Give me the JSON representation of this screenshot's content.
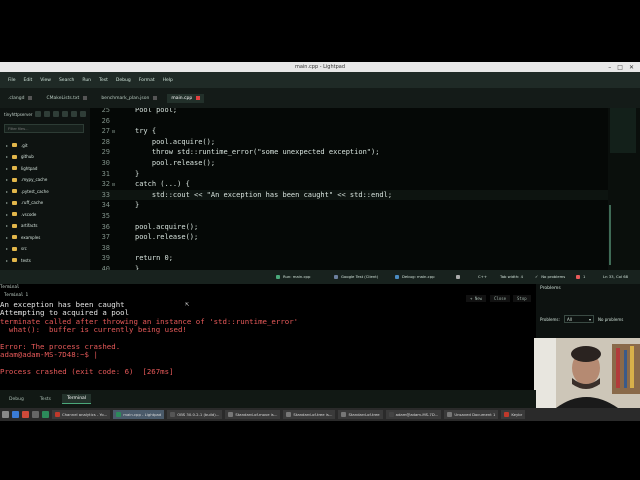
{
  "window": {
    "title": "main.cpp - Lightpad"
  },
  "menu": [
    "File",
    "Edit",
    "View",
    "Search",
    "Run",
    "Test",
    "Debug",
    "Format",
    "Help"
  ],
  "tabs": [
    {
      "label": ".clangd",
      "active": false
    },
    {
      ".label": "",
      "label": "CMakeLists.txt",
      "active": false
    },
    {
      "label": "benchmark_plan.json",
      "active": false
    },
    {
      "label": "main.cpp",
      "active": true
    }
  ],
  "sidebar": {
    "project": "tinyhttpserver",
    "filter_placeholder": "Filter files...",
    "items": [
      ".git",
      "github",
      "lightpad",
      ".mypy_cache",
      ".pytest_cache",
      ".ruff_cache",
      ".vscode",
      "artifacts",
      "examples",
      "src",
      "tests"
    ]
  },
  "editor": {
    "lines": [
      {
        "n": "25",
        "text": "Pool pool;",
        "fold": ""
      },
      {
        "n": "26",
        "text": "",
        "fold": ""
      },
      {
        "n": "27",
        "text": "try {",
        "fold": "⊟"
      },
      {
        "n": "28",
        "text": "    pool.acquire();",
        "fold": ""
      },
      {
        "n": "29",
        "text": "    throw std::runtime_error(\"some unexpected exception\");",
        "fold": ""
      },
      {
        "n": "30",
        "text": "    pool.release();",
        "fold": ""
      },
      {
        "n": "31",
        "text": "}",
        "fold": ""
      },
      {
        "n": "32",
        "text": "catch (...) {",
        "fold": "⊟"
      },
      {
        "n": "33",
        "text": "    std::cout << \"An exception has been caught\" << std::endl;",
        "fold": ""
      },
      {
        "n": "34",
        "text": "}",
        "fold": ""
      },
      {
        "n": "35",
        "text": "",
        "fold": ""
      },
      {
        "n": "36",
        "text": "pool.acquire();",
        "fold": ""
      },
      {
        "n": "37",
        "text": "pool.release();",
        "fold": ""
      },
      {
        "n": "38",
        "text": "",
        "fold": ""
      },
      {
        "n": "39",
        "text": "return 0;",
        "fold": ""
      },
      {
        "n": "40",
        "text": "}",
        "fold": ""
      }
    ]
  },
  "statusbar": {
    "run": "Run: main.cpp",
    "tests": "Google Test (Client)",
    "debug": "Debug: main.cpp",
    "lang": "C++",
    "tabs": "Tab width: 4",
    "problems_ok": "No problems",
    "errors": "1",
    "position": "Ln 33, Col 68"
  },
  "terminal": {
    "header": "Terminal",
    "tab_label": "Terminal 1",
    "buttons": [
      "+ New",
      "Close",
      "Stop"
    ],
    "lines": [
      {
        "text": "An exception has been caught",
        "color": "#e6e6e6"
      },
      {
        "text": "Attempting to acquired a pool",
        "color": "#e6e6e6"
      },
      {
        "text": "terminate called after throwing an instance of 'std::runtime_error'",
        "color": "#e85a5a"
      },
      {
        "text": "  what():  buffer is currently being used!",
        "color": "#e85a5a"
      },
      {
        "text": "",
        "color": "#e6e6e6"
      },
      {
        "text": "Error: The process crashed.",
        "color": "#e85a5a"
      },
      {
        "text": "adam@adam-MS-7D48:~$ |",
        "color": "#e85a5a"
      },
      {
        "text": "",
        "color": "#e6e6e6"
      },
      {
        "text": "Process crashed (exit code: 6)  [267ms]",
        "color": "#e85a5a"
      }
    ]
  },
  "problems": {
    "title": "Problems",
    "filter_label": "Problems:",
    "filter_value": "All",
    "status": "No problems"
  },
  "bottom_tabs": [
    {
      "label": "Debug",
      "active": false
    },
    {
      "label": "Tests",
      "active": false
    },
    {
      "label": "Terminal",
      "active": true
    }
  ],
  "taskbar": [
    {
      "label": "Channel analytics - Yo...",
      "color": "#c0392b",
      "active": false
    },
    {
      "label": "main.cpp - Lightpad",
      "color": "#2c8a5a",
      "active": true
    },
    {
      "label": "OBS 30.0.2-1 (build)...",
      "color": "#555",
      "active": false
    },
    {
      "label": "Standard-of-move is...",
      "color": "#777",
      "active": false
    },
    {
      "label": "Standard-of-tree is...",
      "color": "#777",
      "active": false
    },
    {
      "label": "Standard-of-tree",
      "color": "#777",
      "active": false
    },
    {
      "label": "adam@adam-MS-7D...",
      "color": "#444",
      "active": false
    },
    {
      "label": "Unsaved Document 1",
      "color": "#777",
      "active": false
    },
    {
      "label": "Keybr",
      "color": "#c0392b",
      "active": false
    }
  ],
  "colors": {
    "accent": "#4aa87a",
    "error": "#e85a5a",
    "editor_bg": "#050806"
  }
}
